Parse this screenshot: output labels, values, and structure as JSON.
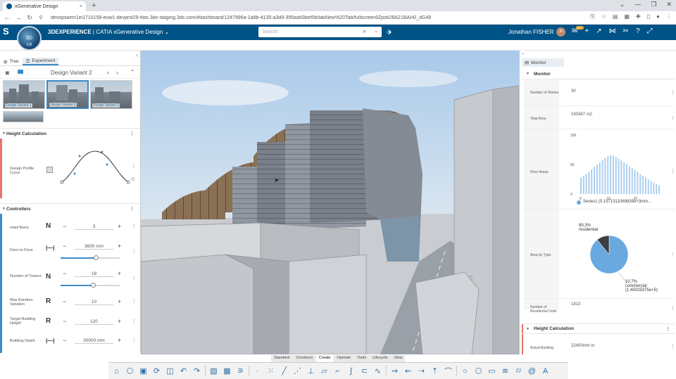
{
  "browser": {
    "tab_title": "xGenerative Design",
    "url": "devopswmr1ei1710158-euw1-devprol29-ifws.3dx-staging.3ds.com/#dashboard/1247996a-1a8b-4135-a3d9-395add3bef0b/tabNew%20Tab/fullscreen9Zpok28A21BAH0_dG49"
  },
  "app": {
    "brand": "3DEXPERIENCE",
    "brand_separator": " | ",
    "app_name": "CATIA xGenerative Design",
    "compass_label": "3D",
    "compass_sub": "V,R",
    "search_placeholder": "Search",
    "user_name": "Jonathan FISHER",
    "user_initials": "JF",
    "notification_count": "99+"
  },
  "left_panel": {
    "tabs": [
      {
        "label": "Tree"
      },
      {
        "label": "Experiment"
      }
    ],
    "variant_title": "Design Variant 2",
    "thumbnails": [
      {
        "label": "Design Variant 1"
      },
      {
        "label": "Design Variant 2"
      },
      {
        "label": "Design Variant 3"
      }
    ],
    "height_calc": {
      "title": "Height Calculation",
      "param_label": "Design Profile Curve"
    },
    "controllers": {
      "title": "Controllers",
      "params": [
        {
          "label": "retail floors",
          "value": "3",
          "icon": "N"
        },
        {
          "label": "Floor to Floor",
          "value": "3600 mm",
          "icon": "|—|",
          "slider": 0.6
        },
        {
          "label": "Number of Towers",
          "value": "18",
          "icon": "N",
          "slider": 0.55
        },
        {
          "label": "Max Random Variation",
          "value": "10",
          "icon": "R"
        },
        {
          "label": "Target Building Height",
          "value": "120",
          "icon": "R"
        },
        {
          "label": "Building Depth",
          "value": "30000 mm",
          "icon": "|—|"
        }
      ]
    }
  },
  "right_panel": {
    "tab_label": "Monitor",
    "section_title": "Monitor",
    "rows": [
      {
        "label": "Number of Stories",
        "value": "30"
      },
      {
        "label": "Total Area",
        "value": "160487 m2"
      },
      {
        "label": "Floor Areas",
        "value": ""
      },
      {
        "label": "Area by Type",
        "value": ""
      },
      {
        "label": "Number of Residential Units",
        "value": "1813"
      }
    ],
    "height_calc_title": "Height Calculation",
    "actual_height_label": "Actual Building",
    "actual_height_value": "22400mm m"
  },
  "chart_data": [
    {
      "type": "bar",
      "name": "Floor Areas",
      "x": [
        0,
        1,
        2,
        3,
        4,
        5,
        6,
        7,
        8,
        9,
        10,
        11,
        12,
        13,
        14,
        15,
        16,
        17,
        18,
        19,
        20,
        21,
        22,
        23,
        24,
        25,
        26,
        27,
        28,
        29
      ],
      "values": [
        28,
        31,
        34,
        38,
        42,
        46,
        50,
        54,
        58,
        61,
        64,
        66,
        65,
        63,
        60,
        57,
        54,
        51,
        47,
        44,
        41,
        38,
        34,
        31,
        28,
        25,
        22,
        19,
        17,
        15
      ],
      "xticks": [
        "0",
        "10",
        "20"
      ],
      "yticks": [
        "0",
        "50",
        "100"
      ],
      "ylim": [
        0,
        100
      ],
      "legend": "Series1 (5.1571311069839e+3mm..."
    },
    {
      "type": "pie",
      "name": "Area by Type",
      "slices": [
        {
          "label": "residential",
          "value": 89.3,
          "display": "89.3%",
          "color": "#6aa9e0"
        },
        {
          "label": "commercial",
          "value": 10.7,
          "display": "10.7%",
          "sub": "(1.45025375e+5)",
          "color": "#3b3f44"
        }
      ]
    }
  ],
  "bottom_tabs": [
    "Standard",
    "Construct",
    "Create",
    "Operate",
    "Tools",
    "Lifecycle",
    "View"
  ],
  "active_bottom_tab": "Create"
}
